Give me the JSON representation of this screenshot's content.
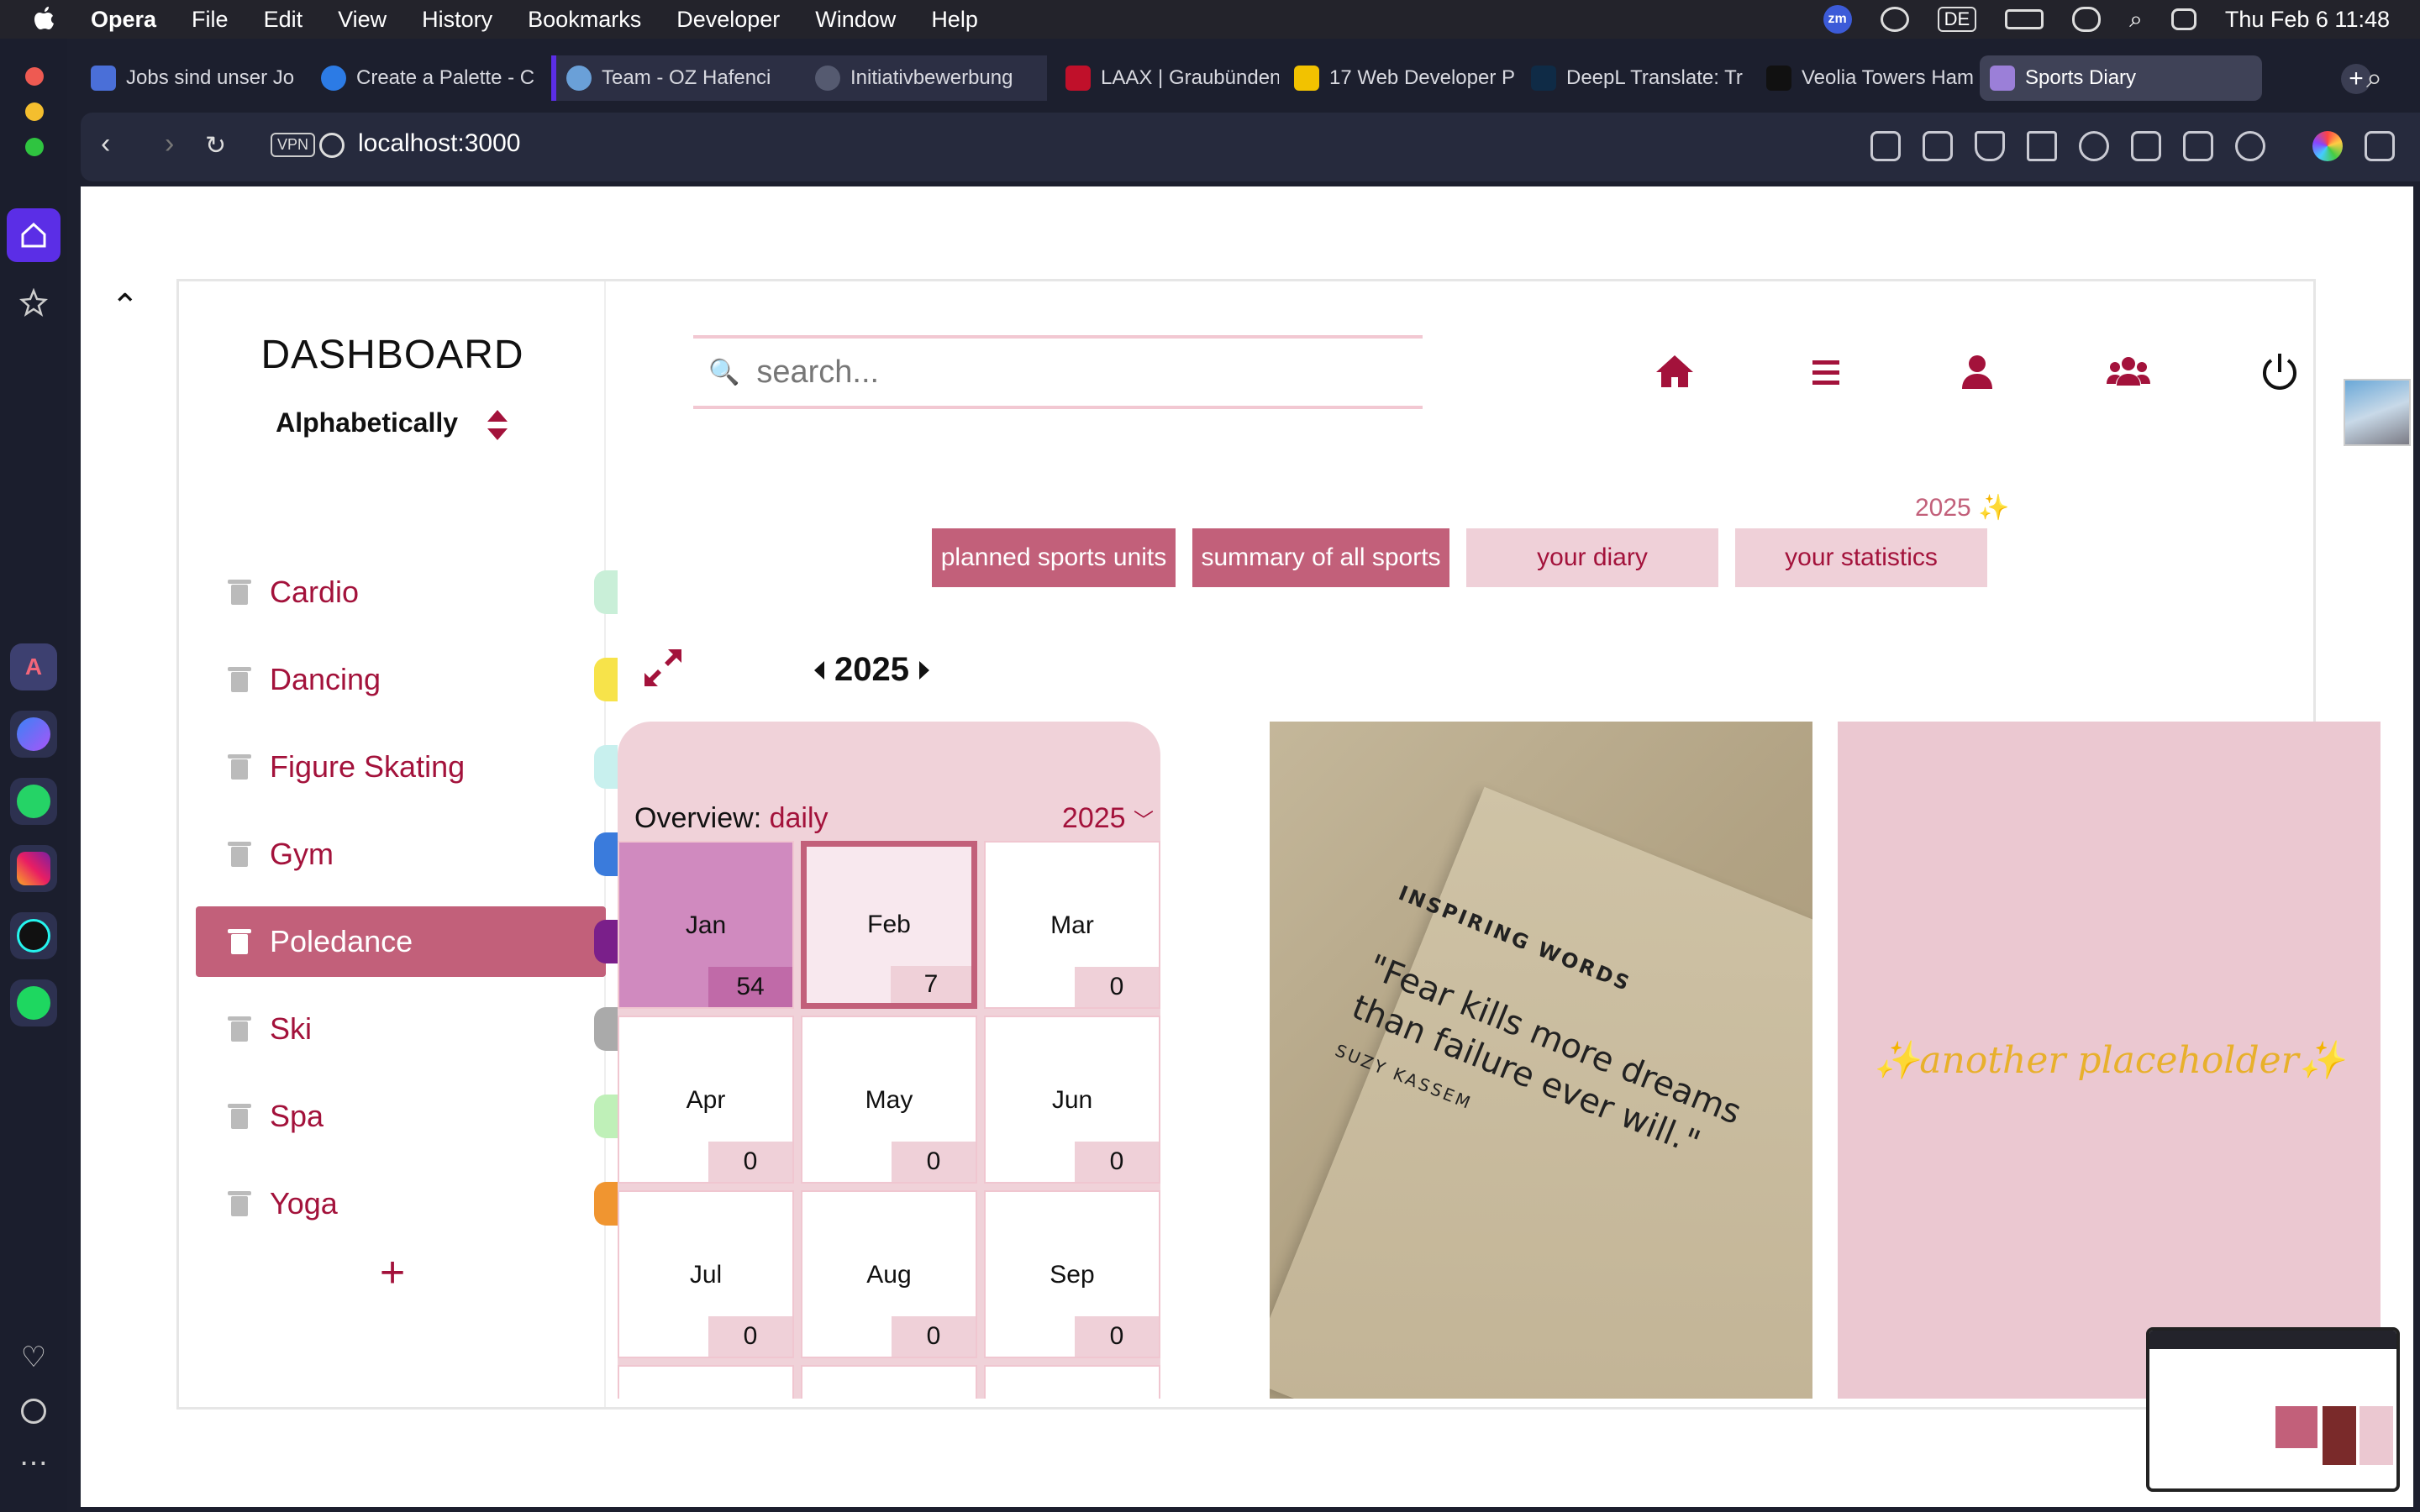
{
  "menubar": {
    "app": "Opera",
    "items": [
      "File",
      "Edit",
      "View",
      "History",
      "Bookmarks",
      "Developer",
      "Window",
      "Help"
    ],
    "zoom_badge": "zm",
    "input_source": "DE",
    "datetime": "Thu Feb 6  11:48"
  },
  "tabs": [
    {
      "title": "Jobs sind unser Jo",
      "color": "#4a6fd8"
    },
    {
      "title": "Create a Palette - C",
      "color": "#2c7be5"
    },
    {
      "title": "Team - OZ Hafenci",
      "color": "#6aa0d8"
    },
    {
      "title": "Initiativbewerbung",
      "color": "#555a70"
    },
    {
      "title": "LAAX | Graubünden",
      "color": "#c0102a"
    },
    {
      "title": "17 Web Developer P",
      "color": "#f2c200"
    },
    {
      "title": "DeepL Translate: Tr",
      "color": "#0f2b46"
    },
    {
      "title": "Veolia Towers Ham",
      "color": "#111111"
    },
    {
      "title": "Sports Diary",
      "color": "#9b7fd8"
    }
  ],
  "address": {
    "vpn": "VPN",
    "url": "localhost:3000"
  },
  "dashboard": {
    "title": "DASHBOARD",
    "sort_label": "Alphabetically",
    "sports": [
      {
        "name": "Cardio",
        "color": "#c9efd8"
      },
      {
        "name": "Dancing",
        "color": "#f7e34a"
      },
      {
        "name": "Figure Skating",
        "color": "#c8f0ee"
      },
      {
        "name": "Gym",
        "color": "#3a7bdc"
      },
      {
        "name": "Poledance",
        "color": "#7a1f8a",
        "selected": true
      },
      {
        "name": "Ski",
        "color": "#aaaaaa"
      },
      {
        "name": "Spa",
        "color": "#bff0b8"
      },
      {
        "name": "Yoga",
        "color": "#f09530"
      }
    ],
    "add_label": "+"
  },
  "main": {
    "search_placeholder": "search...",
    "year_tag": "2025 ✨",
    "tabs": [
      {
        "label": "planned sports units",
        "active": true
      },
      {
        "label": "summary of all sports",
        "active": true
      },
      {
        "label": "your diary",
        "active": false
      },
      {
        "label": "your statistics",
        "active": false
      }
    ],
    "year": "2025",
    "overview_label": "Overview:",
    "overview_mode": "daily",
    "overview_year": "2025",
    "months": [
      {
        "name": "Jan",
        "count": "54"
      },
      {
        "name": "Feb",
        "count": "7"
      },
      {
        "name": "Mar",
        "count": "0"
      },
      {
        "name": "Apr",
        "count": "0"
      },
      {
        "name": "May",
        "count": "0"
      },
      {
        "name": "Jun",
        "count": "0"
      },
      {
        "name": "Jul",
        "count": "0"
      },
      {
        "name": "Aug",
        "count": "0"
      },
      {
        "name": "Sep",
        "count": "0"
      }
    ],
    "quote": {
      "heading": "INSPIRING WORDS",
      "text": "\"Fear kills more dreams than failure ever will.\"",
      "author": "SUZY KASSEM"
    },
    "placeholder": "✨another placeholder✨"
  },
  "colors": {
    "accent": "#a3123b",
    "accent_soft": "#c2607a",
    "pink_bg": "#efd0d8"
  }
}
